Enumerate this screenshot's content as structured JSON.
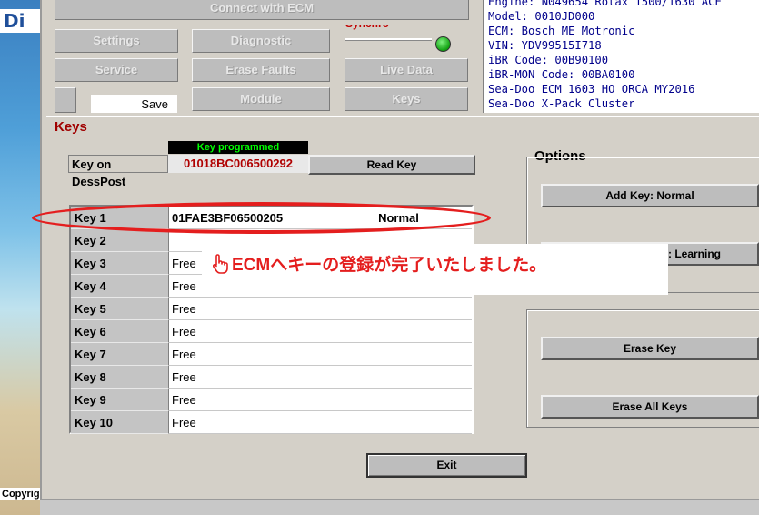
{
  "desktop": {
    "logo_text": "Di",
    "copyright_text": "Copyrig"
  },
  "toolbar": {
    "connect": "Connect with ECM",
    "settings": "Settings",
    "diagnostic": "Diagnostic",
    "service": "Service",
    "erase_faults": "Erase Faults",
    "live_data": "Live Data",
    "module": "Module",
    "keys": "Keys",
    "save": "Save",
    "sync_label": "Synchro"
  },
  "info_lines": [
    "Engine: N049654 Rotax 1500/1630 ACE",
    "Model: 0010JD000",
    "ECM: Bosch ME Motronic",
    "VIN: YDV99515I718",
    "iBR Code: 00B90100",
    "iBR-MON Code: 00BA0100",
    "Sea-Doo ECM 1603 HO ORCA MY2016",
    "Sea-Doo X-Pack  Cluster"
  ],
  "keys": {
    "title": "Keys",
    "status": "Key programmed",
    "key_on_label": "Key on DessPost",
    "key_on_value": "01018BC006500292",
    "read_key": "Read Key",
    "rows": [
      {
        "name": "Key 1",
        "id": "01FAE3BF06500205",
        "mode": "Normal"
      },
      {
        "name": "Key 2",
        "id": "",
        "mode": ""
      },
      {
        "name": "Key 3",
        "id": "Free",
        "mode": ""
      },
      {
        "name": "Key 4",
        "id": "Free",
        "mode": ""
      },
      {
        "name": "Key 5",
        "id": "Free",
        "mode": ""
      },
      {
        "name": "Key 6",
        "id": "Free",
        "mode": ""
      },
      {
        "name": "Key 7",
        "id": "Free",
        "mode": ""
      },
      {
        "name": "Key 8",
        "id": "Free",
        "mode": ""
      },
      {
        "name": "Key 9",
        "id": "Free",
        "mode": ""
      },
      {
        "name": "Key 10",
        "id": "Free",
        "mode": ""
      }
    ]
  },
  "options": {
    "title": "Options",
    "add_key": "Add Key: Normal",
    "add_key_learning": "y: Learning",
    "erase_key": "Erase Key",
    "erase_all": "Erase All Keys"
  },
  "exit": "Exit",
  "annotation": {
    "text": "ECMへキーの登録が完了いたしました。",
    "color": "#e41e1e"
  },
  "colors": {
    "status_text": "#00ff00",
    "title": "#a00000",
    "info_text": "#00008b",
    "sync_led": "#10a010"
  }
}
